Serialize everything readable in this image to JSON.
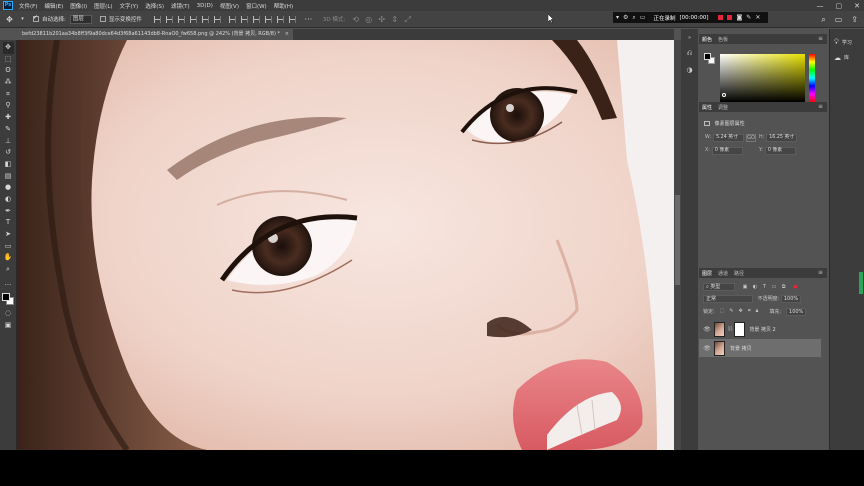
{
  "app": {
    "logo": "Ps"
  },
  "menu": {
    "items": [
      "文件(F)",
      "编辑(E)",
      "图像(I)",
      "图层(L)",
      "文字(Y)",
      "选择(S)",
      "滤镜(T)",
      "3D(D)",
      "视图(V)",
      "窗口(W)",
      "帮助(H)"
    ],
    "window_controls": [
      "—",
      "▢",
      "✕"
    ]
  },
  "options": {
    "auto_select_label": "自动选择:",
    "auto_select_value": "图层",
    "show_transform_label": "显示变换控件",
    "mode_3d_label": "3D 模式:"
  },
  "recorder": {
    "status_label": "正在录制",
    "timer": "[00:00:00]"
  },
  "document": {
    "tab_title": "befd23811b201aa34b8ff3f9a80dce64d3f68a61143db8-RnaO0_fw658.png @ 242% (背景 拷贝, RGB/8) *",
    "close": "×"
  },
  "color_panel": {
    "tabs": [
      "颜色",
      "色板"
    ],
    "active_tab": 0,
    "foreground": "#000000",
    "background": "#ffffff"
  },
  "properties_panel": {
    "tabs": [
      "属性",
      "调整"
    ],
    "active_tab": 0,
    "title": "像素图层属性",
    "w_label": "W:",
    "w_value": "5.24 英寸",
    "h_label": "H:",
    "h_value": "16.25 英寸",
    "x_label": "X:",
    "x_value": "0 像素",
    "y_label": "Y:",
    "y_value": "0 像素",
    "link_symbol": "GO"
  },
  "layers_panel": {
    "tabs": [
      "图层",
      "通道",
      "路径"
    ],
    "active_tab": 0,
    "filter_kind": "类型",
    "blend_mode": "正常",
    "opacity_label": "不透明度:",
    "opacity_value": "100%",
    "lock_label": "锁定:",
    "fill_label": "填充:",
    "fill_value": "100%",
    "layers": [
      {
        "name": "背景 拷贝 2",
        "selected": false,
        "has_mask": true
      },
      {
        "name": "背景 拷贝",
        "selected": true,
        "has_mask": false
      }
    ]
  },
  "learn_panel": {
    "items": [
      {
        "label": "学习",
        "icon": "lightbulb-icon"
      },
      {
        "label": "库",
        "icon": "library-icon"
      }
    ]
  },
  "colors": {
    "accent": "#31a8ff",
    "record": "#e0283a",
    "handle": "#2ea35b"
  }
}
